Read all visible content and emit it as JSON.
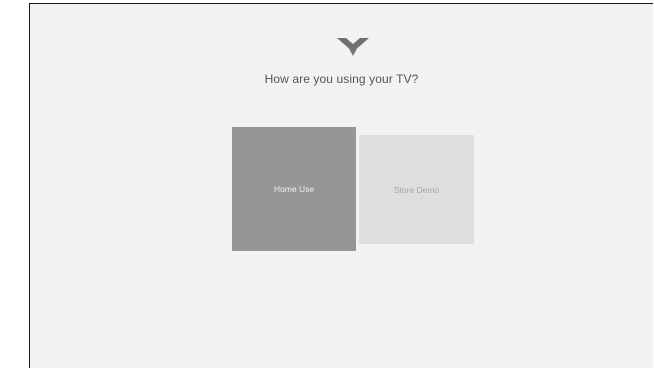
{
  "setup": {
    "logo_icon": "vizio-v-logo-icon",
    "question": "How are you using your TV?",
    "options": [
      {
        "label": "Home Use",
        "state": "selected"
      },
      {
        "label": "Store Demo",
        "state": "unselected"
      }
    ]
  },
  "colors": {
    "background": "#f2f2f2",
    "selected_tile": "#969696",
    "unselected_tile": "#dedede",
    "logo": "#707070"
  }
}
